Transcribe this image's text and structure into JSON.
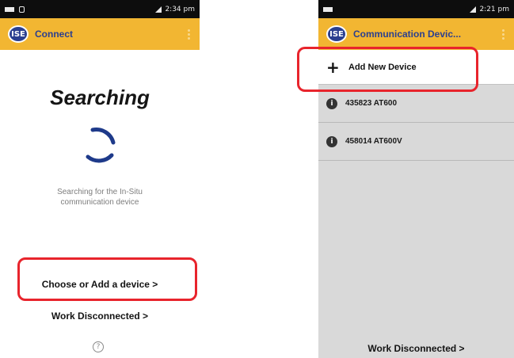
{
  "left": {
    "status": {
      "time": "2:34 pm"
    },
    "appbar": {
      "title": "Connect",
      "logo_text": "ISE"
    },
    "heading": "Searching",
    "description_line1": "Searching for the In-Situ",
    "description_line2": "communication device",
    "choose_link": "Choose or Add a device >",
    "work_disconnected": "Work Disconnected >",
    "help_glyph": "?"
  },
  "right": {
    "status": {
      "time": "2:21 pm"
    },
    "appbar": {
      "title": "Communication Devic...",
      "logo_text": "ISE"
    },
    "add_device": "Add New Device",
    "devices": [
      {
        "label": "435823 AT600"
      },
      {
        "label": "458014 AT600V"
      }
    ],
    "work_disconnected": "Work Disconnected >"
  },
  "colors": {
    "appbar": "#f2b632",
    "brand_blue": "#2b3f8f",
    "highlight": "#e8242c",
    "list_bg": "#d9d9d9"
  },
  "icons": [
    "battery-icon",
    "lock-icon",
    "signal-icon",
    "brand-logo-icon",
    "overflow-menu-icon",
    "spinner-icon",
    "help-icon",
    "plus-icon",
    "info-icon"
  ]
}
